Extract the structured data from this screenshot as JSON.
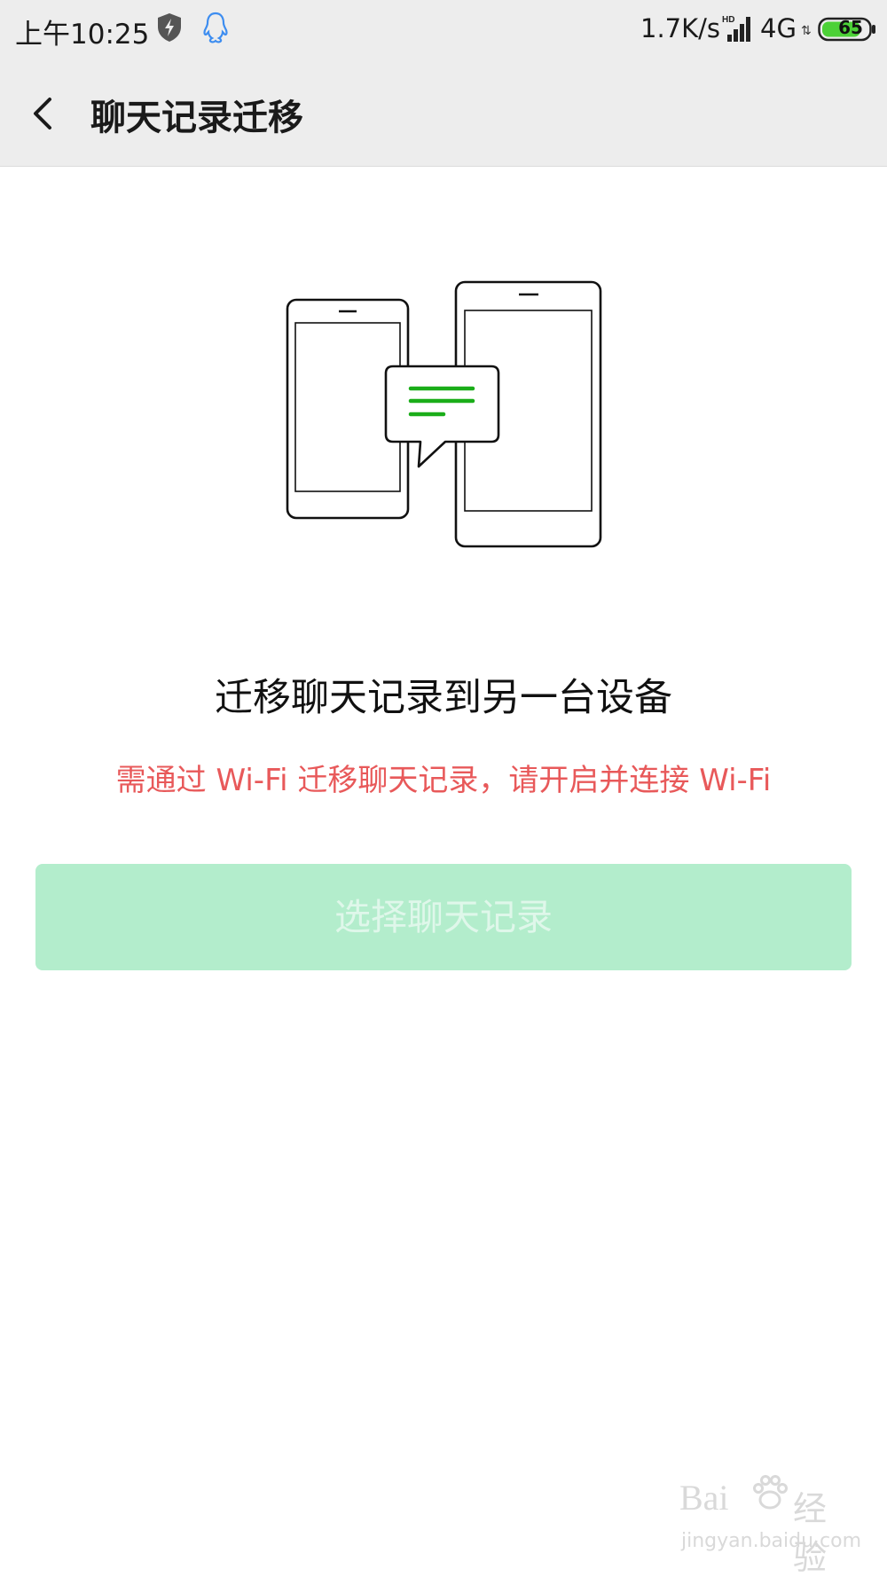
{
  "status_bar": {
    "time": "上午10:25",
    "net_speed": "1.7K/s",
    "network_type": "4G",
    "hd_label": "HD",
    "data_arrows": "⇅",
    "battery_level": "65",
    "icons": [
      "shield-icon",
      "qq-icon",
      "signal-icon",
      "battery-icon"
    ]
  },
  "toolbar": {
    "title": "聊天记录迁移",
    "back_icon": "chevron-left-icon"
  },
  "main": {
    "illustration_icon": "phones-transfer-illustration",
    "heading": "迁移聊天记录到另一台设备",
    "warning": "需通过 Wi-Fi 迁移聊天记录，请开启并连接 Wi-Fi",
    "select_button_label": "选择聊天记录"
  },
  "watermark": {
    "logo": "Bai",
    "logo_suffix": "经验",
    "url": "jingyan.baidu.com"
  },
  "colors": {
    "bar_background": "#ededed",
    "accent_green": "#1aad19",
    "warning_red": "#e8595a",
    "disabled_button": "#b3edcc",
    "disabled_button_text": "#dff7ea"
  }
}
